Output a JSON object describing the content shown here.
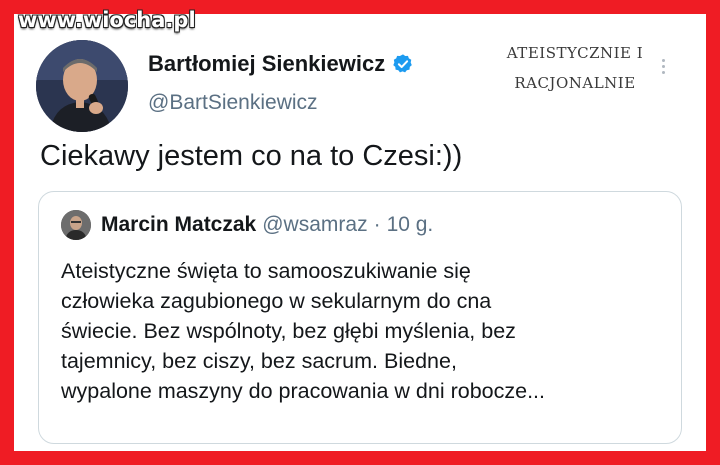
{
  "watermark": "www.wiocha.pl",
  "author": {
    "name": "Bartłomiej Sienkiewicz",
    "handle": "@BartSienkiewicz",
    "avatar_icon": "person-portrait-with-microphone",
    "verified_icon": "verified-badge-icon"
  },
  "stamp": {
    "line1": "ATEISTYCZNIE I",
    "line2": "RACJONALNIE"
  },
  "tweet": {
    "text": "Ciekawy jestem co na to Czesi:))"
  },
  "quote": {
    "name": "Marcin Matczak",
    "handle": "@wsamraz",
    "separator": "·",
    "time": "10 g.",
    "lines": [
      "Ateistyczne święta to samooszukiwanie się",
      "człowieka zagubionego w sekularnym do cna",
      "świecie. Bez wspólnoty, bez głębi myślenia, bez",
      "tajemnicy, bez ciszy, bez sacrum. Biedne,",
      "wypalone maszyny do pracowania w dni robocze..."
    ]
  },
  "colors": {
    "frame": "#ef1c24",
    "verified": "#1d9bf0",
    "secondary_text": "#5b7083"
  }
}
